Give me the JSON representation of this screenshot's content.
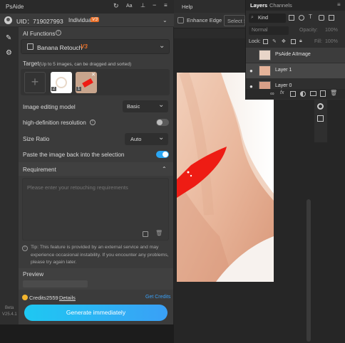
{
  "plugin": {
    "title": "PsAide",
    "uid_label": "UID：719027993",
    "plan_label": "Individual",
    "plan_badge": "V3",
    "title_icons": [
      "refresh-icon",
      "font-size-icon",
      "pin-icon",
      "minimize-icon",
      "menu-icon"
    ],
    "ai_functions": {
      "label": "AI Functions",
      "selected": "Banana Retouch",
      "selected_badge": "V3"
    },
    "target": {
      "label": "Target",
      "hint": "(Up to 5 images, can be dragged and sorted)",
      "thumbs": [
        {
          "badge": "2"
        },
        {
          "badge": "1"
        }
      ]
    },
    "image_editing_model": {
      "label": "Image editing model",
      "value": "Basic"
    },
    "high_definition": {
      "label": "high-definition resolution",
      "enabled": false
    },
    "size_ratio": {
      "label": "Size Ratio",
      "value": "Auto"
    },
    "paste_back": {
      "label": "Paste the image back into the selection",
      "enabled": true
    },
    "requirement": {
      "label": "Requirement",
      "placeholder": "Please enter your retouching requirements"
    },
    "tip": "Tip: This feature is provided by an external service and may experience occasional instability. If you encounter any problems, please try again later.",
    "preview_label": "Preview",
    "credits_label": "Credits:",
    "credits_value": "2559",
    "details_link": "Details",
    "get_credits_link": "Get Credits",
    "generate_button": "Generate immediately",
    "version_line1": "Beta",
    "version_line2": "V25.4.1"
  },
  "photoshop": {
    "menu_help": "Help",
    "enhance_edge": "Enhance Edge",
    "select_partial": "Select Su",
    "layers_panel": {
      "tabs": [
        "Layers",
        "Channels"
      ],
      "kind_label": "Kind",
      "blend_mode": "Normal",
      "opacity_label": "Opacity:",
      "opacity_value": "100%",
      "lock_label": "Lock:",
      "fill_label": "Fill:",
      "fill_value": "100%",
      "layers": [
        {
          "name": "PsAide AIImage",
          "visible": false
        },
        {
          "name": "Layer 1",
          "visible": true
        },
        {
          "name": "Layer 0",
          "visible": true
        }
      ]
    }
  },
  "colors": {
    "accent": "#2aa6f3",
    "link": "#3aa0f6",
    "badge": "#e8702a",
    "red_band": "#ee1c14"
  }
}
